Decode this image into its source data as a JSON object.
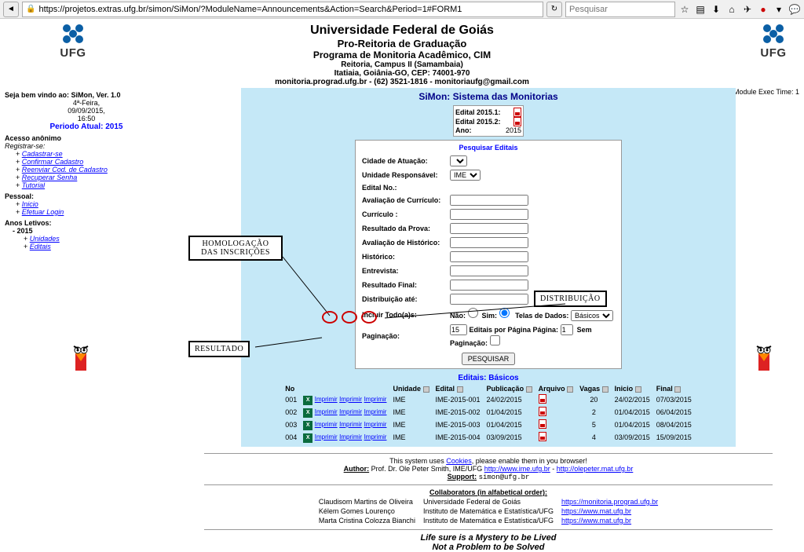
{
  "browser": {
    "url": "https://projetos.extras.ufg.br/simon/SiMon/?ModuleName=Announcements&Action=Search&Period=1#FORM1",
    "search_placeholder": "Pesquisar"
  },
  "header": {
    "title": "Universidade Federal de Goiás",
    "subtitle": "Pro-Reitoria de Graduação",
    "program": "Programa de Monitoria Acadêmico, CIM",
    "campus": "Reitoria, Campus II (Samambaia)",
    "address": "Itatiaia, Goiânia-GO, CEP: 74001-970",
    "contact": "monitoria.prograd.ufg.br - (62) 3521-1816 - monitoriaufg@gmail.com",
    "logo_text": "UFG"
  },
  "mod_time": "Module Exec Time: 1",
  "left": {
    "welcome": "Seja bem vindo ao: SiMon, Ver. 1.0",
    "day": "4ª-Feira,",
    "date": "09/09/2015,",
    "time": "16:50",
    "period": "Periodo Atual: 2015",
    "anon": "Acesso anônimo",
    "registrar": "Registrar-se:",
    "reg_items": [
      "Cadastrar-se",
      "Confirmar Cadastro",
      "Reenviar Cod. de Cadastro",
      "Recuperar Senha",
      "Tutorial"
    ],
    "pessoal": "Pessoal:",
    "pessoal_items": [
      "Inicio",
      "Efetuar Login"
    ],
    "anos": "Anos Letivos:",
    "ano_label": "- 2015",
    "ano_items": [
      "Unidades",
      "Editais"
    ]
  },
  "content": {
    "title": "SiMon: Sistema das Monitorias",
    "edital1": "Edital 2015.1:",
    "edital2": "Edital 2015.2:",
    "ano_label": "Ano:",
    "ano_val": "2015"
  },
  "form": {
    "title": "Pesquisar Editais",
    "cidade": "Cidade de Atuação:",
    "unidade": "Unidade Responsável:",
    "unidade_val": "IME",
    "edital_no": "Edital No.:",
    "aval_curr": "Avaliação de Currículo:",
    "curriculo": "Currículo :",
    "res_prova": "Resultado da Prova:",
    "aval_hist": "Avaliação de Histórico:",
    "historico": "Histórico:",
    "entrevista": "Entrevista:",
    "res_final": "Resultado Final:",
    "distrib": "Distribuição até:",
    "incluir": "Incluir Todo(a)s:",
    "nao": "Não:",
    "sim": "Sim:",
    "telas": "Telas de Dados:",
    "telas_val": "Básicos",
    "paginacao": "Paginação:",
    "pag_val": "15",
    "pag_label": "Editais por Página Página:",
    "pag_num": "1",
    "sem_pag": "Sem Paginação:",
    "btn": "PESQUISAR"
  },
  "table": {
    "title": "Editais: Básicos",
    "headers": {
      "no": "No",
      "unidade": "Unidade",
      "edital": "Edital",
      "publicacao": "Publicação",
      "arquivo": "Arquivo",
      "vagas": "Vagas",
      "inicio": "Inicio",
      "final": "Final"
    },
    "rows": [
      {
        "no": "001",
        "unidade": "IME",
        "edital": "IME-2015-001",
        "pub": "24/02/2015",
        "vagas": "20",
        "inicio": "24/02/2015",
        "final": "07/03/2015"
      },
      {
        "no": "002",
        "unidade": "IME",
        "edital": "IME-2015-002",
        "pub": "01/04/2015",
        "vagas": "2",
        "inicio": "01/04/2015",
        "final": "06/04/2015"
      },
      {
        "no": "003",
        "unidade": "IME",
        "edital": "IME-2015-003",
        "pub": "01/04/2015",
        "vagas": "5",
        "inicio": "01/04/2015",
        "final": "08/04/2015"
      },
      {
        "no": "004",
        "unidade": "IME",
        "edital": "IME-2015-004",
        "pub": "03/09/2015",
        "vagas": "4",
        "inicio": "03/09/2015",
        "final": "15/09/2015"
      }
    ],
    "imprimir": "Imprimir"
  },
  "callouts": {
    "homolog1": "HOMOLOGAÇÃO",
    "homolog2": "DAS INSCRIÇÕES",
    "resultado": "RESULTADO",
    "distrib": "DISTRIBUIÇÃO"
  },
  "footer": {
    "cookies1": "This system uses ",
    "cookies_link": "Cookies",
    "cookies2": ", please enable them in you browser!",
    "author_label": "Author:",
    "author": "Prof. Dr. Ole Peter Smith, IME/UFG",
    "author_link1": "http://www.ime.ufg.br",
    "author_link2": "http://olepeter.mat.ufg.br",
    "support_label": "Support:",
    "support": "simon@ufg.br",
    "collab_title": "Collaborators (in alfabetical order):",
    "collab": [
      {
        "name": "Claudisom Martins de Oliveira",
        "inst": "Universidade Federal de Goiás",
        "link": "https://monitoria.prograd.ufg.br"
      },
      {
        "name": "Kélem Gomes Lourenço",
        "inst": "Instituto de Matemática e Estatística/UFG",
        "link": "https://www.mat.ufg.br"
      },
      {
        "name": "Marta Cristina Colozza Bianchi",
        "inst": "Instituto de Matemática e Estatística/UFG",
        "link": "https://www.mat.ufg.br"
      }
    ],
    "quote1": "Life sure is a Mystery to be Lived",
    "quote2": "Not a Problem to be Solved"
  }
}
